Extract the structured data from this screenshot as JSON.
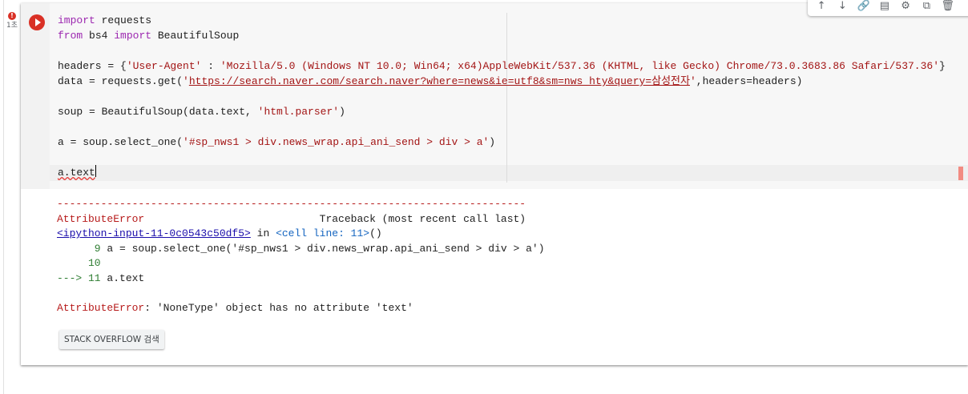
{
  "cell_status": {
    "error_glyph": "!",
    "exec_time": "1초"
  },
  "toolbar": {
    "icons": [
      "arrow-up-icon",
      "arrow-down-icon",
      "link-icon",
      "comment-icon",
      "gear-icon",
      "mirror-icon",
      "delete-icon",
      "more-icon"
    ],
    "glyphs": {
      "up": "↑",
      "down": "↓",
      "link": "🔗",
      "comment": "▤",
      "settings": "⚙",
      "mirror": "⧉",
      "delete": "🗑",
      "more": "⋮"
    }
  },
  "code": {
    "l1_kw": "import",
    "l1_rest": " requests",
    "l2_kw1": "from",
    "l2_mid": " bs4 ",
    "l2_kw2": "import",
    "l2_rest": " BeautifulSoup",
    "l4_a": "headers = {",
    "l4_s1": "'User-Agent'",
    "l4_b": " : ",
    "l4_s2": "'Mozilla/5.0 (Windows NT 10.0; Win64; x64)AppleWebKit/537.36 (KHTML, like Gecko) Chrome/73.0.3683.86 Safari/537.36'",
    "l4_c": "}",
    "l5_a": "data = requests.get(",
    "l5_q1": "'",
    "l5_url": "https://search.naver.com/search.naver?where=news&ie=utf8&sm=nws_hty&query=삼성전자",
    "l5_q2": "'",
    "l5_b": ",headers=headers)",
    "l7_a": "soup = BeautifulSoup(data.text, ",
    "l7_s": "'html.parser'",
    "l7_b": ")",
    "l9_a": "a = soup.select_one(",
    "l9_s": "'#sp_nws1 > div.news_wrap.api_ani_send > div > a'",
    "l9_b": ")",
    "l11": "a.text"
  },
  "output": {
    "dashes": "---------------------------------------------------------------------------",
    "err_name": "AttributeError",
    "traceback_label": "                            Traceback (most recent call last)",
    "input_link": "<ipython-input-11-0c0543c50df5>",
    "in_word": " in ",
    "cell_line": "<cell line: 11>",
    "parens": "()",
    "tb_line9_num": "      9",
    "tb_line9_code": " a = soup.select_one('#sp_nws1 > div.news_wrap.api_ani_send > div > a')",
    "tb_line10": "     10",
    "tb_arrow": "---> 11",
    "tb_line11_code": " a.text",
    "final_name": "AttributeError",
    "final_msg": ": 'NoneType' object has no attribute 'text'"
  },
  "buttons": {
    "stack_overflow": "STACK OVERFLOW 검색"
  },
  "colors": {
    "error_red": "#d93025",
    "keyword": "#9c27b0",
    "string": "#a31515"
  }
}
